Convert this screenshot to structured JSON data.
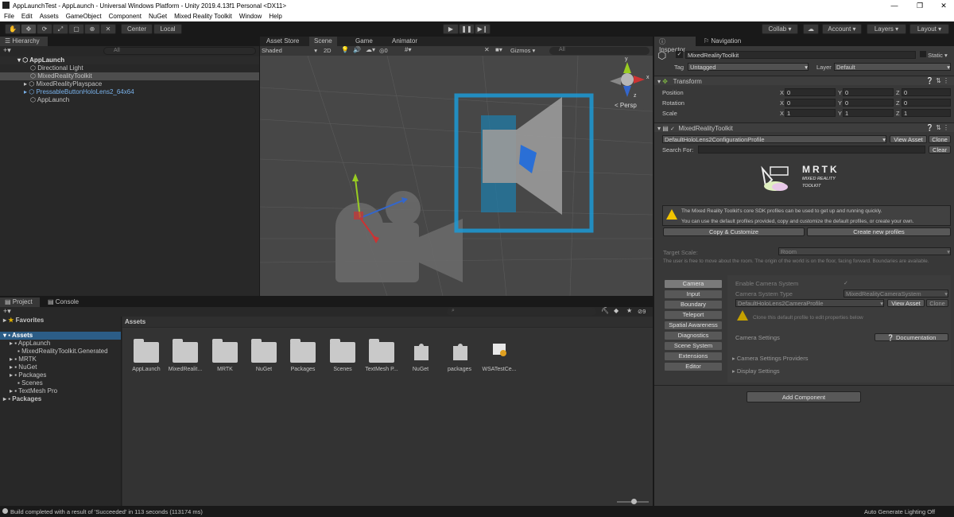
{
  "window": {
    "title": "AppLaunchTest - AppLaunch - Universal Windows Platform - Unity 2019.4.13f1 Personal <DX11>"
  },
  "menu": [
    "File",
    "Edit",
    "Assets",
    "GameObject",
    "Component",
    "NuGet",
    "Mixed Reality Toolkit",
    "Window",
    "Help"
  ],
  "toolbar": {
    "center": "Center",
    "local": "Local",
    "collab": "Collab",
    "account": "Account",
    "layers": "Layers",
    "layout": "Layout"
  },
  "hierarchy": {
    "tab": "Hierarchy",
    "search_placeholder": "All",
    "scene": "AppLaunch",
    "items": [
      "Directional Light",
      "MixedRealityToolkit",
      "MixedRealityPlayspace",
      "PressableButtonHoloLens2_64x64",
      "AppLaunch"
    ]
  },
  "scene": {
    "tabs": [
      "Asset Store",
      "Scene",
      "Game",
      "Animator"
    ],
    "shading": "Shaded",
    "mode2d": "2D",
    "fx_count": "0",
    "gizmos": "Gizmos",
    "search_placeholder": "All",
    "persp": "< Persp",
    "axis_labels": {
      "y": "y",
      "x": "x",
      "z": "z"
    }
  },
  "project": {
    "tabs": [
      "Project",
      "Console"
    ],
    "favorites": "Favorites",
    "tree": [
      "Assets",
      "AppLaunch",
      "MixedRealityToolkit.Generated",
      "MRTK",
      "NuGet",
      "Packages",
      "Scenes",
      "TextMesh Pro",
      "Packages"
    ],
    "breadcrumb": "Assets",
    "hidden_count": "9",
    "items": [
      {
        "label": "AppLaunch",
        "kind": "folder"
      },
      {
        "label": "MixedRealit...",
        "kind": "folder"
      },
      {
        "label": "MRTK",
        "kind": "folder"
      },
      {
        "label": "NuGet",
        "kind": "folder"
      },
      {
        "label": "Packages",
        "kind": "folder"
      },
      {
        "label": "Scenes",
        "kind": "folder"
      },
      {
        "label": "TextMesh P...",
        "kind": "folder"
      },
      {
        "label": "NuGet",
        "kind": "puzzle"
      },
      {
        "label": "packages",
        "kind": "puzzle"
      },
      {
        "label": "WSATestCe...",
        "kind": "cert"
      }
    ]
  },
  "inspector": {
    "tabs": [
      "Inspector",
      "Navigation"
    ],
    "object_name": "MixedRealityToolkit",
    "static": "Static",
    "tag_label": "Tag",
    "tag": "Untagged",
    "layer_label": "Layer",
    "layer": "Default",
    "transform": {
      "title": "Transform",
      "rows": [
        {
          "label": "Position",
          "x": "0",
          "y": "0",
          "z": "0"
        },
        {
          "label": "Rotation",
          "x": "0",
          "y": "0",
          "z": "0"
        },
        {
          "label": "Scale",
          "x": "1",
          "y": "1",
          "z": "1"
        }
      ]
    },
    "mrtk": {
      "title": "MixedRealityToolkit",
      "profile": "DefaultHoloLens2ConfigurationProfile",
      "view_asset": "View Asset",
      "clone": "Clone",
      "search_for": "Search For:",
      "clear": "Clear",
      "logo_big": "MRTK",
      "logo_small1": "MIXED REALITY",
      "logo_small2": "TOOLKIT",
      "info1": "The Mixed Reality Toolkit's core SDK profiles can be used to get up and running quickly.",
      "info2": "You can use the default profiles provided, copy and customize the default profiles, or create your own.",
      "copy_customize": "Copy & Customize",
      "create_new": "Create new profiles",
      "target_scale_label": "Target Scale:",
      "target_scale": "Room",
      "scale_desc": "The user is free to move about the room. The origin of the world is on the floor, facing forward. Boundaries are available.",
      "categories": [
        "Camera",
        "Input",
        "Boundary",
        "Teleport",
        "Spatial Awareness",
        "Diagnostics",
        "Scene System",
        "Extensions",
        "Editor"
      ],
      "enable_camera": "Enable Camera System",
      "camera_type_label": "Camera System Type",
      "camera_type": "MixedRealityCameraSystem",
      "camera_profile": "DefaultHoloLens2CameraProfile",
      "clone_warning": "Clone this default profile to edit properties below",
      "camera_settings": "Camera Settings",
      "documentation": "Documentation",
      "providers": "Camera Settings Providers",
      "display": "Display Settings"
    },
    "add_component": "Add Component"
  },
  "status": {
    "message": "Build completed with a result of 'Succeeded' in 113 seconds (113174 ms)",
    "right": "Auto Generate Lighting Off"
  },
  "colors": {
    "accent": "#2c5d87",
    "mrtk_blue": "#1c9ad6",
    "bg": "#282828"
  }
}
